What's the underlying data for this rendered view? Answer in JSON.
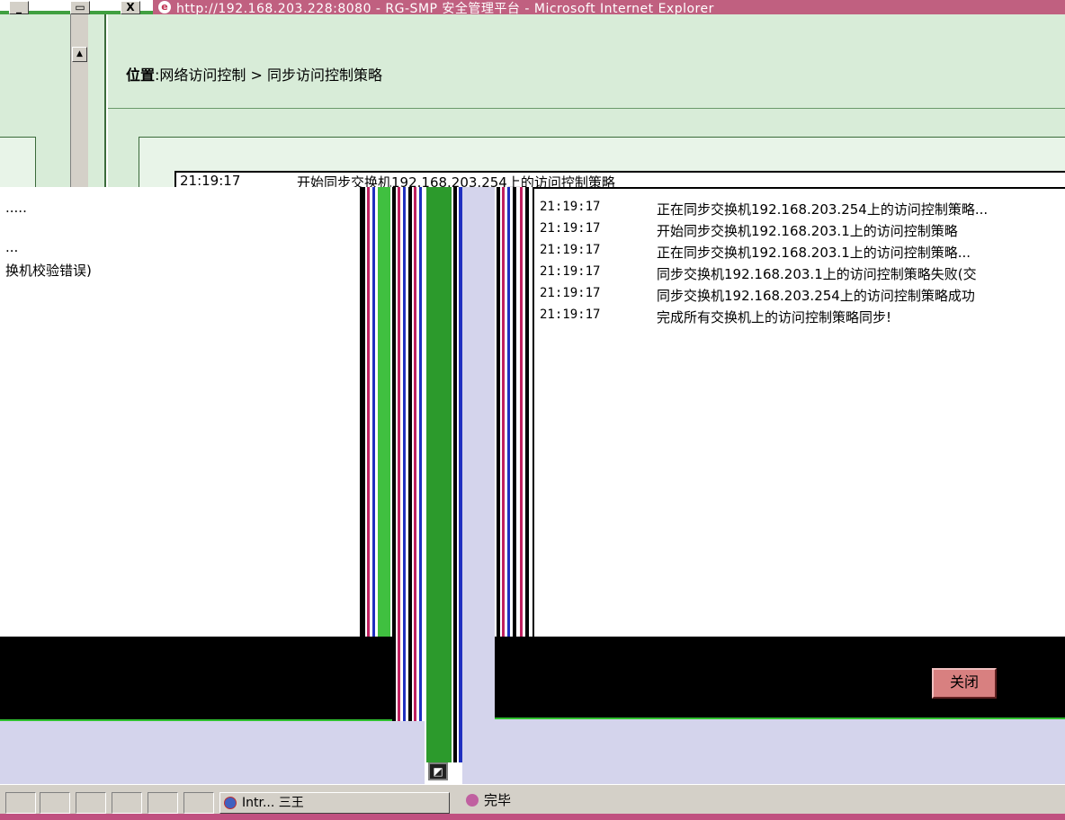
{
  "window": {
    "title": "http://192.168.203.228:8080 - RG-SMP 安全管理平台 - Microsoft Internet Explorer",
    "minimize_glyph": "_",
    "restore_glyph": "▭",
    "close_glyph": "X"
  },
  "breadcrumb": {
    "label": "位置",
    "sep": ":",
    "path": "网络访问控制 > 同步访问控制策略"
  },
  "log_left_lines": [
    ".....",
    "...",
    "换机校验错误)"
  ],
  "first_line": {
    "time": "21:19:17",
    "message": "开始同步交换机192.168.203.254上的访问控制策略"
  },
  "log_rows": [
    {
      "time": "21:19:17",
      "message": "正在同步交换机192.168.203.254上的访问控制策略..."
    },
    {
      "time": "21:19:17",
      "message": "开始同步交换机192.168.203.1上的访问控制策略"
    },
    {
      "time": "21:19:17",
      "message": "正在同步交换机192.168.203.1上的访问控制策略..."
    },
    {
      "time": "21:19:17",
      "message": "同步交换机192.168.203.1上的访问控制策略失败(交"
    },
    {
      "time": "21:19:17",
      "message": "同步交换机192.168.203.254上的访问控制策略成功"
    },
    {
      "time": "21:19:17",
      "message": "完成所有交换机上的访问控制策略同步!"
    }
  ],
  "close_button": {
    "label": "关闭"
  },
  "statusbar": {
    "task_label": "Intr...",
    "task_suffix": "三王",
    "status_text": "完毕",
    "grip_glyph": "◩"
  },
  "colors": {
    "title_bar": "#c06080",
    "content_bg": "#d8ecd8",
    "lavender": "#d4d4ec",
    "close_btn": "#d88080"
  }
}
